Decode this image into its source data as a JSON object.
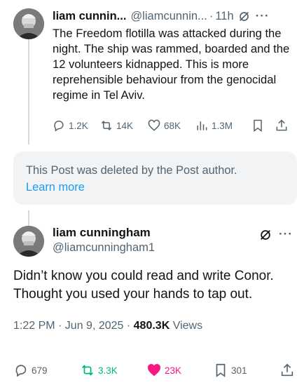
{
  "tweet1": {
    "name": "liam cunnin...",
    "handle": "@liamcunnin...",
    "separator": "·",
    "time": "11h",
    "more": "···",
    "body": "The Freedom flotilla was attacked during the night. The ship was rammed, boarded and the 12 volunteers kidnapped. This is more reprehensible behaviour from the genocidal regime in Tel Aviv.",
    "actions": {
      "replies": "1.2K",
      "reposts": "14K",
      "likes": "68K",
      "views": "1.3M"
    }
  },
  "deleted_post": {
    "message": "This Post was deleted by the Post author.",
    "link": "Learn more"
  },
  "tweet2": {
    "name": "liam cunningham",
    "handle": "@liamcunningham1",
    "more": "···",
    "body": "Didn’t know you could read and write Conor. Thought you used your hands to tap out.",
    "meta_time": "1:22 PM · Jun 9, 2025 · ",
    "meta_views": "480.3K",
    "meta_views_label": " Views",
    "actions": {
      "replies": "679",
      "reposts": "3.3K",
      "likes": "23K",
      "bookmarks": "301"
    }
  },
  "colors": {
    "text": "#0f1419",
    "muted": "#536471",
    "link": "#1d9bf0",
    "repost": "#00ba7c",
    "like": "#f91880",
    "deleted_bg": "#f1f3f5"
  }
}
